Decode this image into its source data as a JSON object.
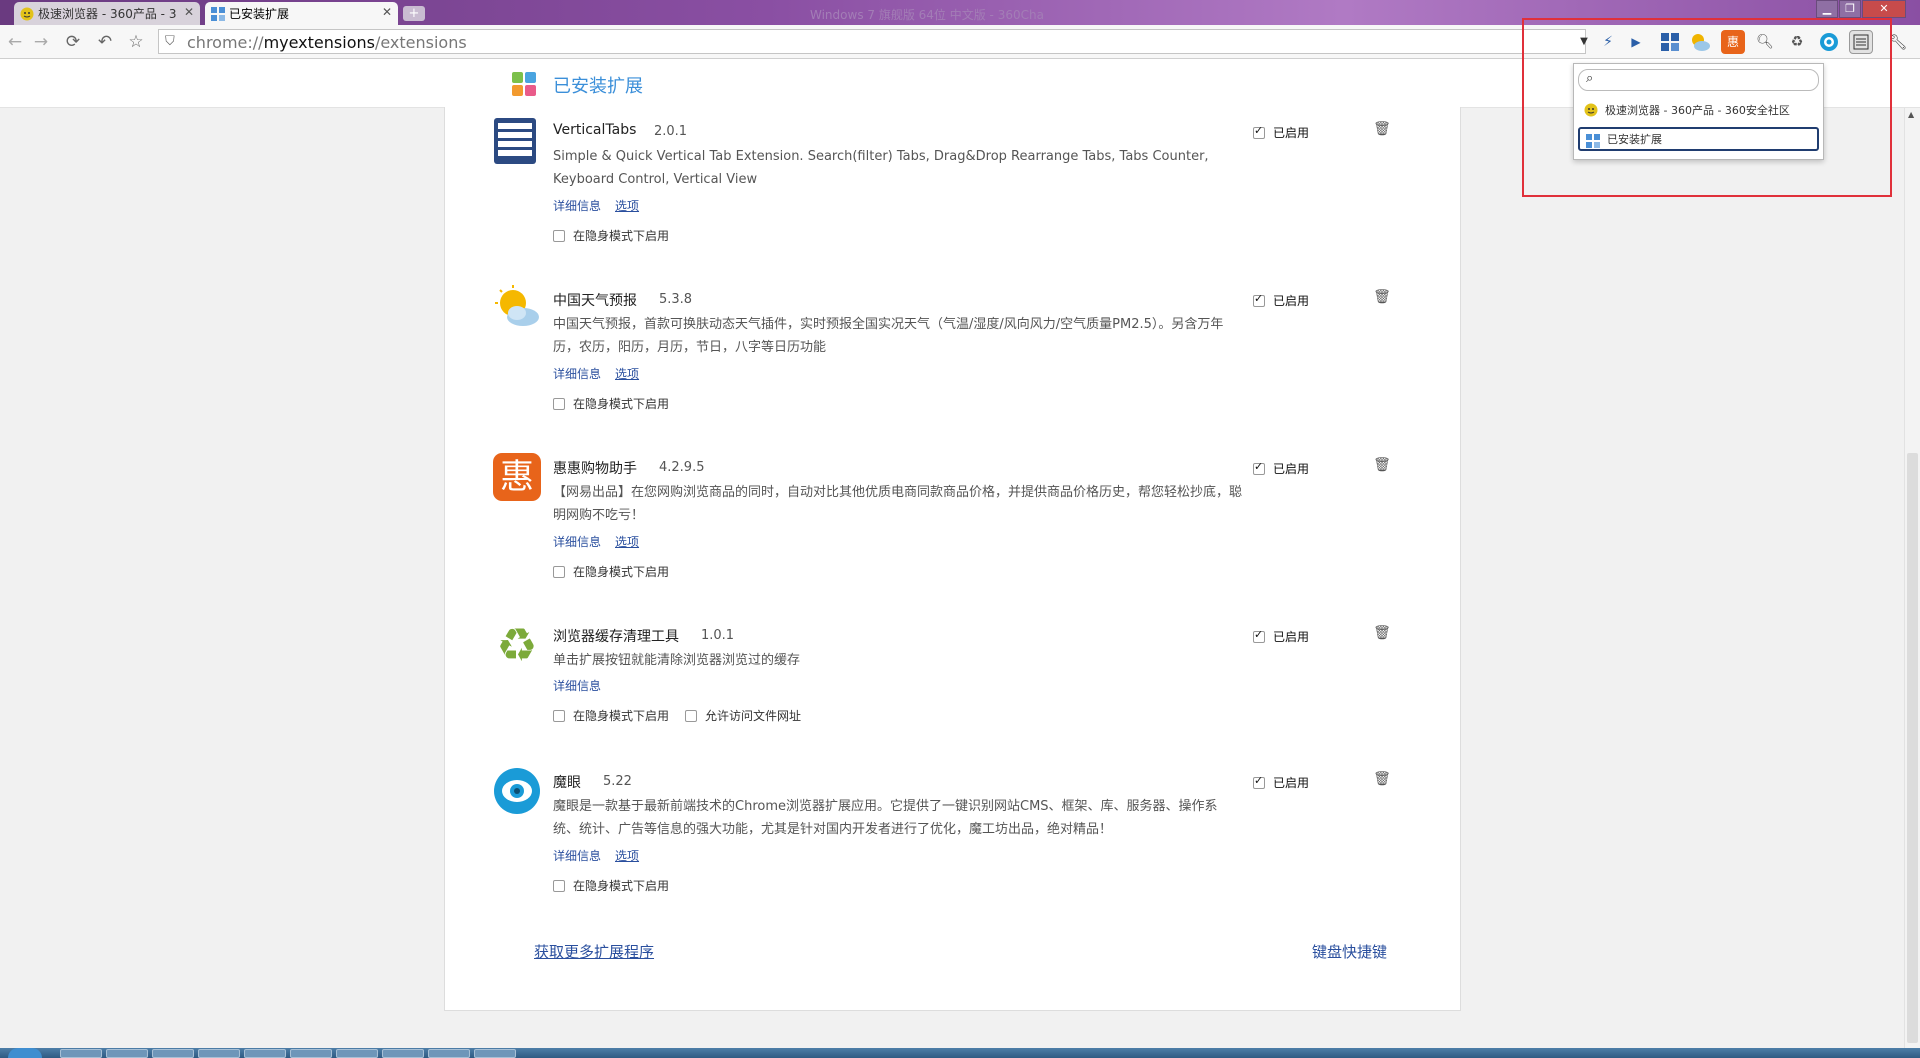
{
  "tabs": [
    {
      "title": "极速浏览器 - 360产品 - 3",
      "active": false
    },
    {
      "title": "已安装扩展",
      "active": true
    }
  ],
  "window_title": "Windows 7 旗舰版 64位 中文版 - 360Cha",
  "window_controls": {
    "minimize": "▁",
    "maximize": "❐",
    "close": "✕"
  },
  "address_bar": {
    "prefix": "chrome://",
    "host": "myextensions",
    "path": "/extensions"
  },
  "page": {
    "title": "已安装扩展"
  },
  "extensions": [
    {
      "name": "VerticalTabs",
      "version": "2.0.1",
      "description": "Simple & Quick Vertical Tab Extension. Search(filter) Tabs, Drag&Drop Rearrange Tabs, Tabs Counter, Keyboard Control, Vertical View",
      "details": "详细信息",
      "options": "选项",
      "incognito": "在隐身模式下启用",
      "enabled_label": "已启用",
      "icon": "vertical-tabs-icon"
    },
    {
      "name": "中国天气预报",
      "version": "5.3.8",
      "description": "中国天气预报，首款可换肤动态天气插件，实时预报全国实况天气（气温/湿度/风向风力/空气质量PM2.5）。另含万年历，农历，阳历，月历，节日，八字等日历功能",
      "details": "详细信息",
      "options": "选项",
      "incognito": "在隐身模式下启用",
      "enabled_label": "已启用",
      "icon": "weather-icon"
    },
    {
      "name": "惠惠购物助手",
      "version": "4.2.9.5",
      "description": "【网易出品】在您网购浏览商品的同时，自动对比其他优质电商同款商品价格，并提供商品价格历史，帮您轻松抄底，聪明网购不吃亏！",
      "details": "详细信息",
      "options": "选项",
      "incognito": "在隐身模式下启用",
      "enabled_label": "已启用",
      "icon": "huihui-icon",
      "icon_char": "惠"
    },
    {
      "name": "浏览器缓存清理工具",
      "version": "1.0.1",
      "description": "单击扩展按钮就能清除浏览器浏览过的缓存",
      "details": "详细信息",
      "incognito": "在隐身模式下启用",
      "file_access": "允许访问文件网址",
      "enabled_label": "已启用",
      "icon": "recycle-icon",
      "icon_char": "♻"
    },
    {
      "name": "魔眼",
      "version": "5.22",
      "description": "魔眼是一款基于最新前端技术的Chrome浏览器扩展应用。它提供了一键识别网站CMS、框架、库、服务器、操作系统、统计、广告等信息的强大功能，尤其是针对国内开发者进行了优化，魔工坊出品，绝对精品！",
      "details": "详细信息",
      "options": "选项",
      "incognito": "在隐身模式下启用",
      "enabled_label": "已启用",
      "icon": "magic-eye-icon"
    }
  ],
  "footer": {
    "get_more": "获取更多扩展程序",
    "shortcuts": "键盘快捷键"
  },
  "dropdown": {
    "items": [
      {
        "label": "极速浏览器 - 360产品 - 360安全社区",
        "selected": false
      },
      {
        "label": "已安装扩展",
        "selected": true
      }
    ]
  },
  "toolbar_extension_icons": [
    "dropdown-arrow-icon",
    "lightning-icon",
    "play-icon",
    "extensions-grid-icon",
    "weather-icon",
    "huihui-icon",
    "search-icon",
    "recycle-icon",
    "magic-eye-icon",
    "vertical-tabs-icon",
    "wrench-icon"
  ],
  "colors": {
    "accent": "#3b8fd9",
    "link": "#2a4f9e",
    "highlight_box": "#e0303a",
    "titlebar": "#8a4fa3"
  }
}
